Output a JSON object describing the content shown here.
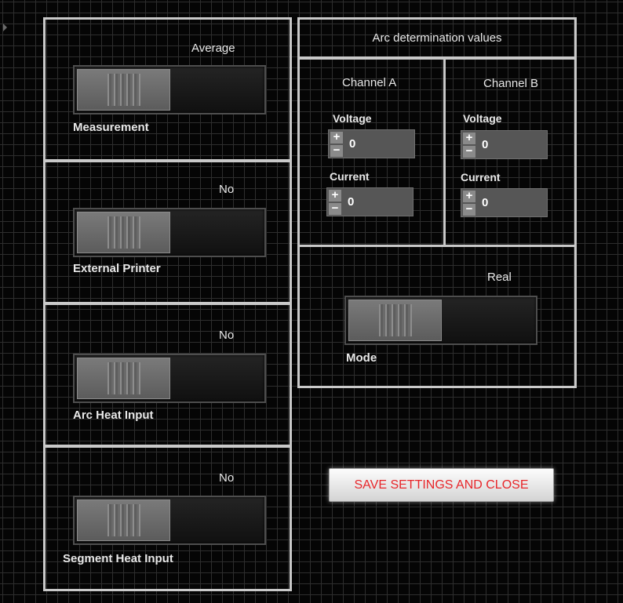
{
  "switches": {
    "measurement": {
      "label": "Measurement",
      "state": "Average"
    },
    "external_printer": {
      "label": "External Printer",
      "state": "No"
    },
    "arc_heat_input": {
      "label": "Arc Heat Input",
      "state": "No"
    },
    "segment_heat_input": {
      "label": "Segment Heat Input",
      "state": "No"
    },
    "mode": {
      "label": "Mode",
      "state": "Real"
    }
  },
  "arc": {
    "title": "Arc determination values",
    "channel_a": {
      "title": "Channel A",
      "voltage_label": "Voltage",
      "voltage": "0",
      "current_label": "Current",
      "current": "0"
    },
    "channel_b": {
      "title": "Channel B",
      "voltage_label": "Voltage",
      "voltage": "0",
      "current_label": "Current",
      "current": "0"
    }
  },
  "save_button": "SAVE SETTINGS AND CLOSE",
  "colors": {
    "background": "#050505",
    "grid": "#2e2e2e",
    "frame": "#c9c9c9",
    "button_text": "#e8262a"
  }
}
